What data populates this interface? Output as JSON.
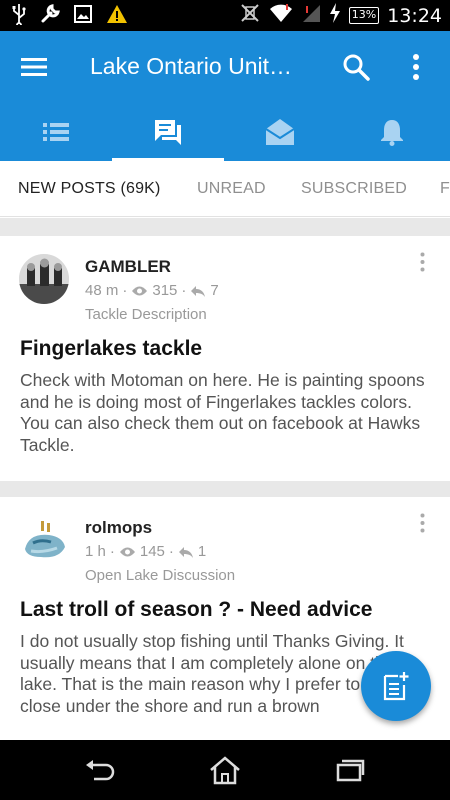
{
  "status_bar": {
    "time": "13:24",
    "battery": "13%",
    "icons": [
      "usb-icon",
      "wrench-icon",
      "image-icon",
      "warning-icon",
      "vibrate-off-icon",
      "wifi-icon",
      "signal-icon",
      "charging-icon",
      "battery-icon"
    ]
  },
  "app_bar": {
    "title": "Lake Ontario Unit…",
    "icons": [
      "menu-icon",
      "search-icon",
      "more-vert-icon"
    ],
    "color": "#1a8bd8"
  },
  "icon_tabs": [
    {
      "icon": "list-icon",
      "active": false
    },
    {
      "icon": "forum-chat-icon",
      "active": true
    },
    {
      "icon": "envelope-open-icon",
      "active": false
    },
    {
      "icon": "bell-icon",
      "active": false
    }
  ],
  "text_tabs": [
    {
      "label": "NEW POSTS (69K)",
      "active": true
    },
    {
      "label": "UNREAD",
      "active": false
    },
    {
      "label": "SUBSCRIBED",
      "active": false
    },
    {
      "label": "F",
      "active": false
    }
  ],
  "posts": [
    {
      "username": "GAMBLER",
      "time": "48 m",
      "views": "315",
      "replies": "7",
      "forum": "Tackle Description",
      "title": "Fingerlakes tackle",
      "body": "Check with Motoman on here.  He is painting spoons and he is doing most of Fingerlakes tackles colors.  You can also check them out on facebook at Hawks Tackle."
    },
    {
      "username": "rolmops",
      "time": "1 h",
      "views": "145",
      "replies": "1",
      "forum": "Open Lake Discussion",
      "title": "Last troll of season ? - Need advice",
      "body": "I do not usually stop fishing until Thanks Giving. It usually means that I am completely alone on the lake. That is the main reason why I prefer to stay close under the shore and run a brown"
    }
  ],
  "fab": {
    "icon": "new-post-icon"
  },
  "nav_bar": {
    "icons": [
      "back-icon",
      "home-icon",
      "recent-apps-icon"
    ]
  }
}
